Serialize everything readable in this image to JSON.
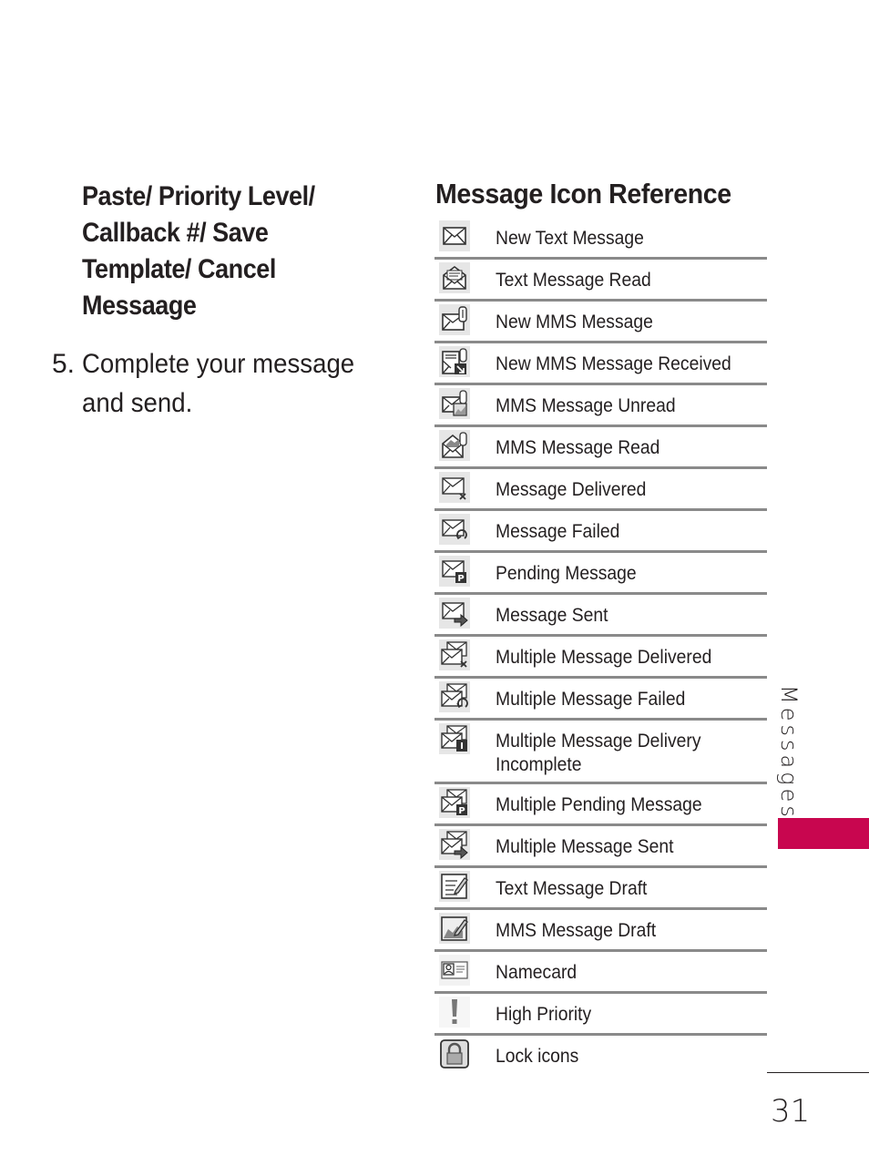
{
  "left": {
    "submenu_heading": "Paste/ Priority Level/ Callback #/ Save Template/ Cancel Messaage",
    "step": {
      "number": "5.",
      "text": "Complete your message and send."
    }
  },
  "reference": {
    "title": "Message Icon Reference",
    "rows": [
      {
        "icon": "new-text-message-icon",
        "label": "New Text Message"
      },
      {
        "icon": "text-message-read-icon",
        "label": "Text Message Read"
      },
      {
        "icon": "new-mms-message-icon",
        "label": "New MMS Message"
      },
      {
        "icon": "new-mms-message-received-icon",
        "label": "New MMS Message Received"
      },
      {
        "icon": "mms-message-unread-icon",
        "label": "MMS Message Unread"
      },
      {
        "icon": "mms-message-read-icon",
        "label": "MMS Message Read"
      },
      {
        "icon": "message-delivered-icon",
        "label": "Message Delivered"
      },
      {
        "icon": "message-failed-icon",
        "label": "Message Failed"
      },
      {
        "icon": "pending-message-icon",
        "label": "Pending Message"
      },
      {
        "icon": "message-sent-icon",
        "label": "Message Sent"
      },
      {
        "icon": "multiple-message-delivered-icon",
        "label": "Multiple Message Delivered"
      },
      {
        "icon": "multiple-message-failed-icon",
        "label": "Multiple Message Failed"
      },
      {
        "icon": "multiple-message-delivery-incomplete-icon",
        "label": "Multiple Message Delivery Incomplete"
      },
      {
        "icon": "multiple-pending-message-icon",
        "label": "Multiple Pending Message"
      },
      {
        "icon": "multiple-message-sent-icon",
        "label": "Multiple Message Sent"
      },
      {
        "icon": "text-message-draft-icon",
        "label": "Text Message Draft"
      },
      {
        "icon": "mms-message-draft-icon",
        "label": "MMS Message Draft"
      },
      {
        "icon": "namecard-icon",
        "label": "Namecard"
      },
      {
        "icon": "high-priority-icon",
        "label": "High Priority"
      },
      {
        "icon": "lock-icon",
        "label": "Lock icons"
      }
    ]
  },
  "section_tab": {
    "label": "Messages",
    "accent_color": "#c8064f"
  },
  "page_number": "31"
}
